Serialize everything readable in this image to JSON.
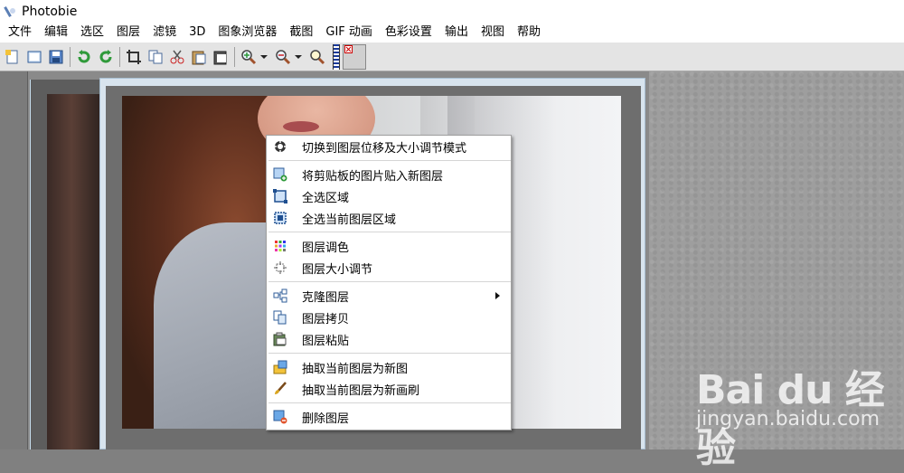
{
  "window": {
    "title": "Photobie"
  },
  "menu": [
    "文件",
    "编辑",
    "选区",
    "图层",
    "滤镜",
    "3D",
    "图象浏览器",
    "截图",
    "GIF 动画",
    "色彩设置",
    "输出",
    "视图",
    "帮助"
  ],
  "toolbar": {
    "buttons": [
      "new-icon",
      "open-icon",
      "save-icon",
      "undo-icon",
      "redo-icon",
      "crop-icon",
      "copy-icon",
      "cut-icon",
      "paste-icon",
      "paste-new-icon",
      "zoom-in-icon",
      "zoom-out-icon",
      "zoom-fit-icon"
    ]
  },
  "context_menu": {
    "items": [
      {
        "label": "切换到图层位移及大小调节模式",
        "icon": "move-resize-icon"
      },
      {
        "label": "将剪贴板的图片贴入新图层",
        "icon": "paste-new-layer-icon"
      },
      {
        "label": "全选区域",
        "icon": "select-all-icon"
      },
      {
        "label": "全选当前图层区域",
        "icon": "select-layer-icon"
      },
      {
        "label": "图层调色",
        "icon": "palette-icon"
      },
      {
        "label": "图层大小调节",
        "icon": "resize-icon"
      },
      {
        "label": "克隆图层",
        "icon": "clone-icon",
        "submenu": true
      },
      {
        "label": "图层拷贝",
        "icon": "copy-layer-icon"
      },
      {
        "label": "图层粘贴",
        "icon": "paste-layer-icon"
      },
      {
        "label": "抽取当前图层为新图",
        "icon": "extract-image-icon"
      },
      {
        "label": "抽取当前图层为新画刷",
        "icon": "brush-icon"
      },
      {
        "label": "删除图层",
        "icon": "delete-layer-icon"
      }
    ]
  },
  "watermark": {
    "logo": "Bai du 经验",
    "site": "jingyan.baidu.com"
  },
  "colors": {
    "workspace": "#8a8a8a",
    "menu_bg": "#ffffff",
    "toolbar_bg": "#e4e4e4"
  }
}
